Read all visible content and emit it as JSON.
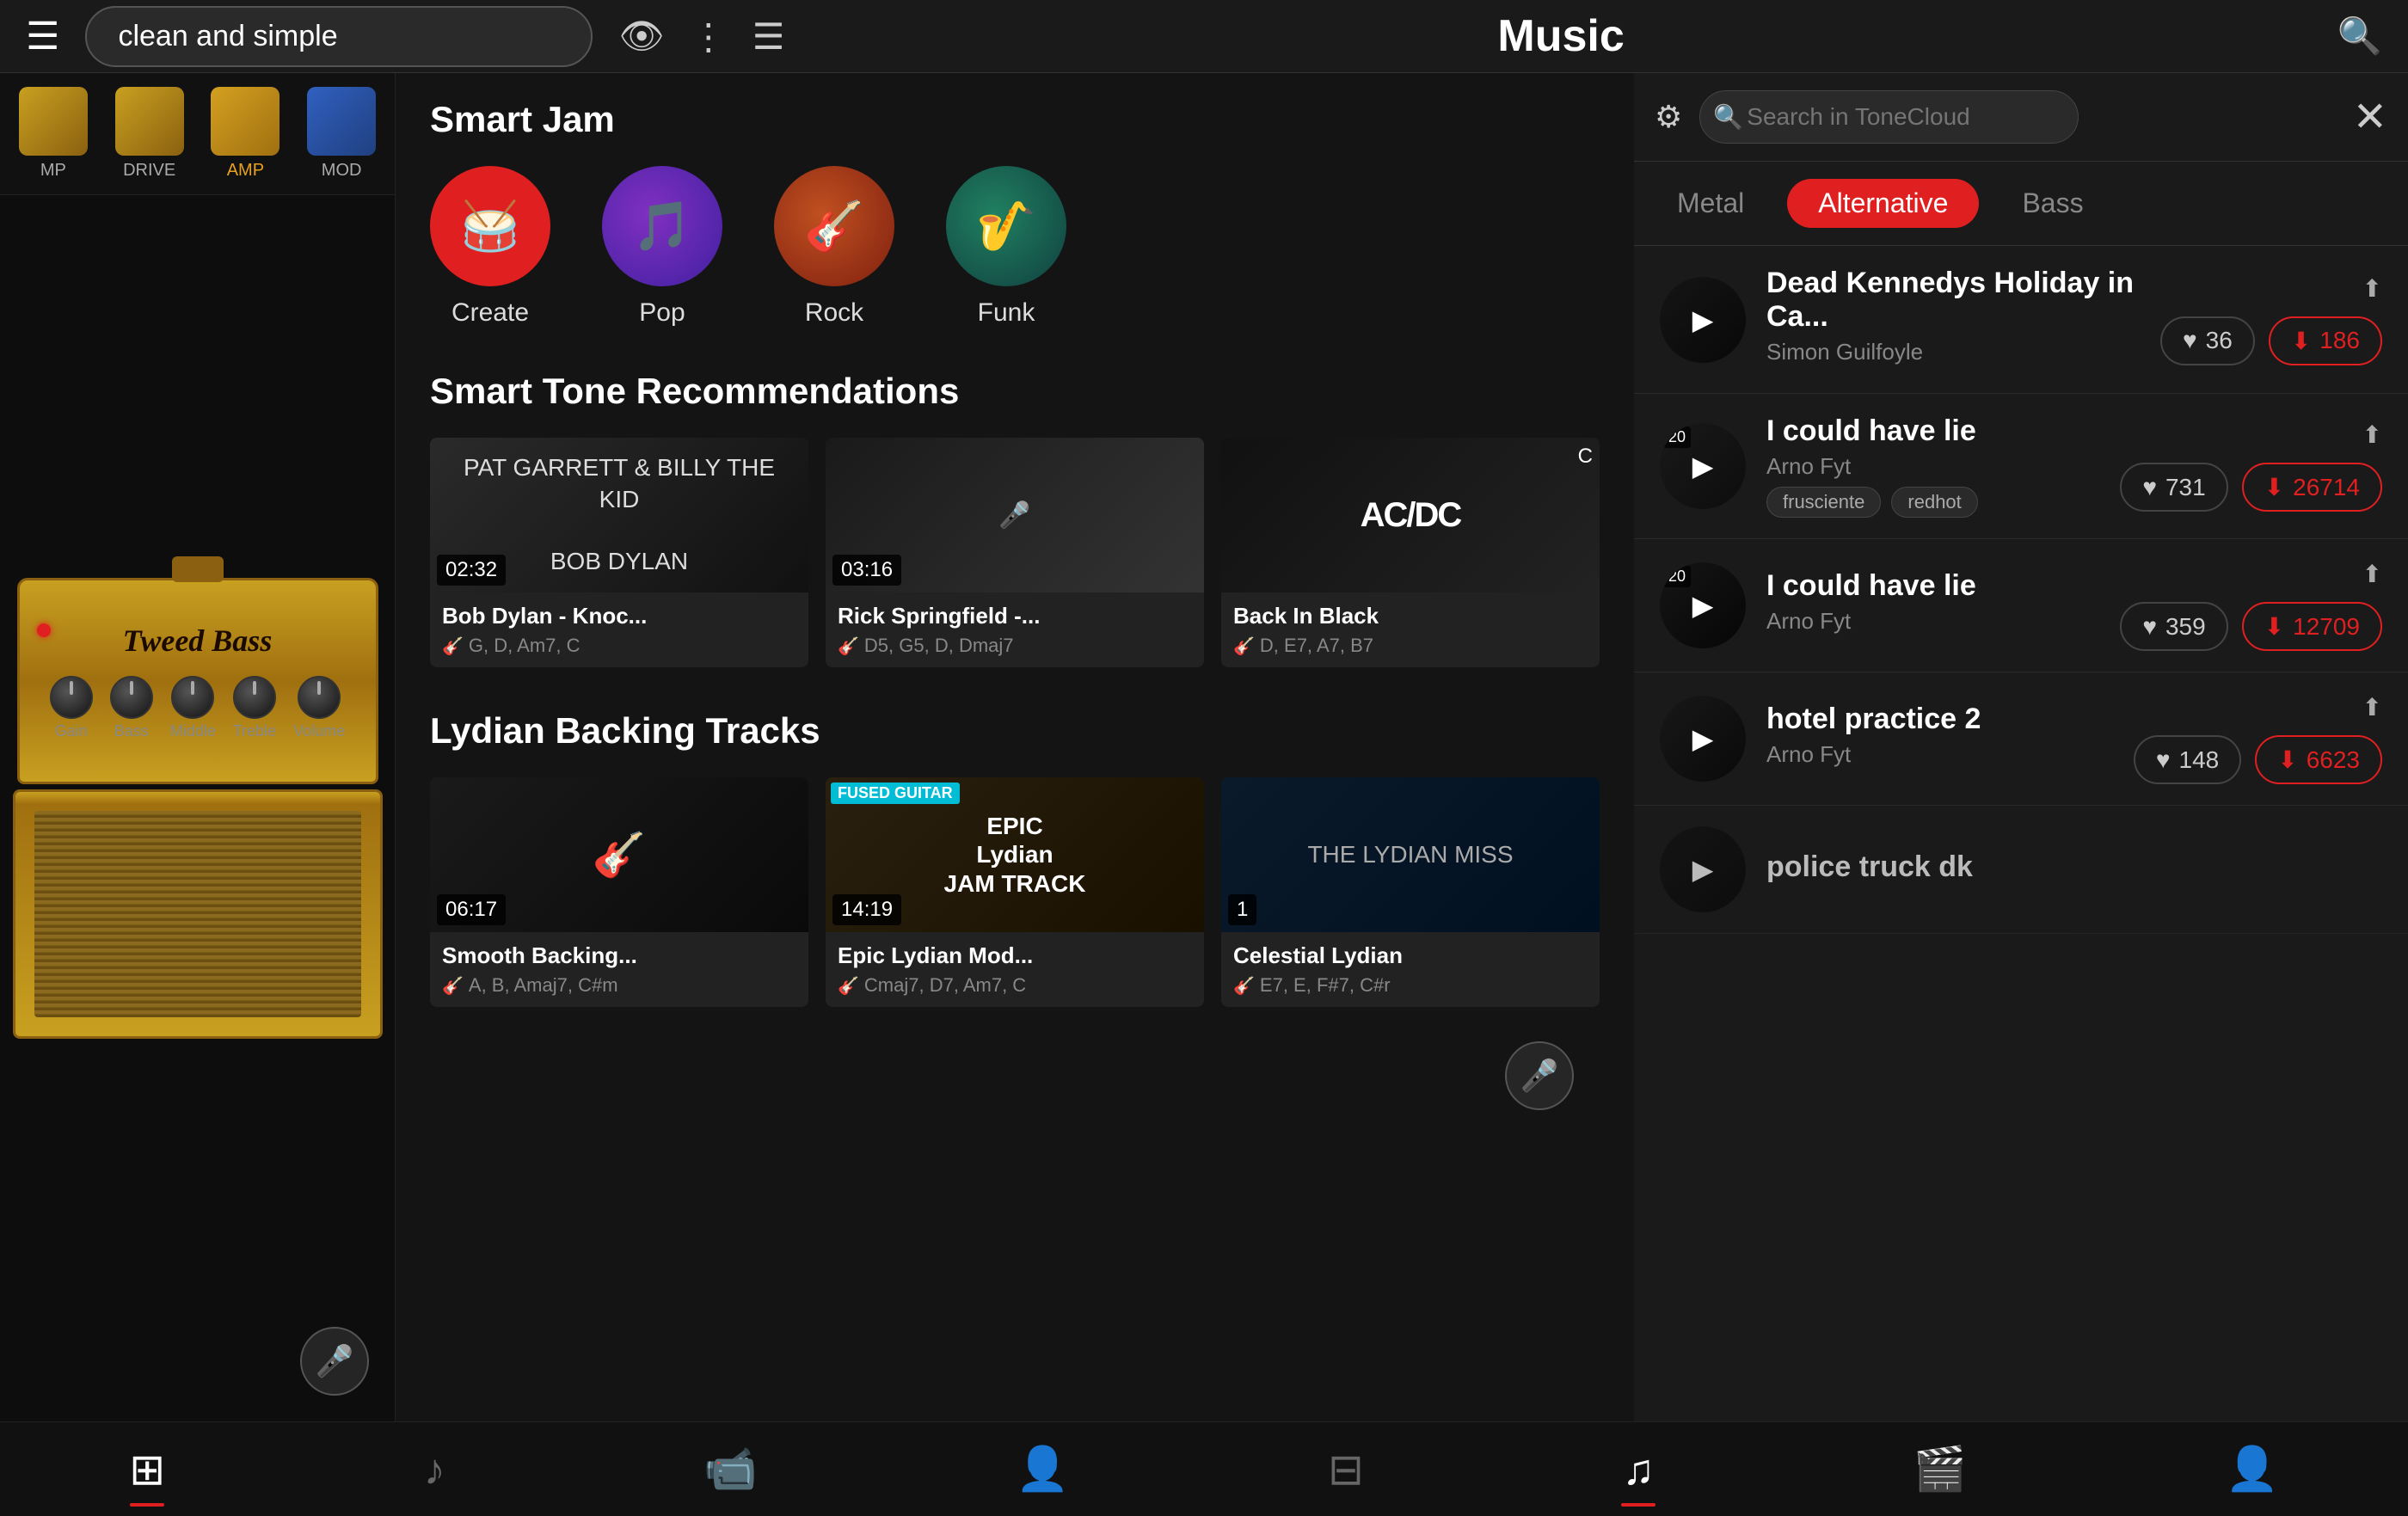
{
  "app": {
    "title": "Music"
  },
  "topBar": {
    "searchValue": "clean and simple",
    "searchPlaceholder": "clean and simple"
  },
  "rightPanel": {
    "searchPlaceholder": "Search in ToneCloud",
    "genres": [
      {
        "id": "metal",
        "label": "Metal",
        "active": false
      },
      {
        "id": "alternative",
        "label": "Alternative",
        "active": true
      },
      {
        "id": "bass",
        "label": "Bass",
        "active": false
      }
    ],
    "tones": [
      {
        "id": "t1",
        "title": "Dead Kennedys Holiday in Ca...",
        "author": "Simon Guilfoyle",
        "tags": [],
        "likes": "36",
        "downloads": "186",
        "hasThumb": true
      },
      {
        "id": "t2",
        "title": "I could have lie",
        "author": "Arno Fyt",
        "tags": [
          "frusciente",
          "redhot"
        ],
        "likes": "731",
        "downloads": "26714",
        "hasThumb": true
      },
      {
        "id": "t3",
        "title": "I could have lie",
        "author": "Arno Fyt",
        "tags": [],
        "likes": "359",
        "downloads": "12709",
        "hasThumb": true
      },
      {
        "id": "t4",
        "title": "hotel practice 2",
        "author": "Arno Fyt",
        "tags": [],
        "likes": "148",
        "downloads": "6623",
        "hasThumb": true
      },
      {
        "id": "t5",
        "title": "police truck dk",
        "author": "",
        "tags": [],
        "likes": "",
        "downloads": "",
        "hasThumb": true,
        "partial": true
      }
    ]
  },
  "leftPanel": {
    "effects": [
      {
        "id": "mp",
        "label": "MP"
      },
      {
        "id": "drive",
        "label": "DRIVE"
      },
      {
        "id": "amp",
        "label": "AMP",
        "highlight": true
      },
      {
        "id": "mod",
        "label": "MOD"
      }
    ],
    "ampName": "Tweed Bass",
    "knobs": [
      {
        "id": "gain",
        "label": "Gain"
      },
      {
        "id": "bass",
        "label": "Bass"
      },
      {
        "id": "middle",
        "label": "Middle"
      },
      {
        "id": "treble",
        "label": "Treble"
      },
      {
        "id": "volume",
        "label": "Volume"
      }
    ]
  },
  "centerPanel": {
    "smartJam": {
      "title": "Smart Jam",
      "items": [
        {
          "id": "create",
          "label": "Create",
          "icon": "🥁"
        },
        {
          "id": "pop",
          "label": "Pop",
          "icon": "🎵"
        },
        {
          "id": "rock",
          "label": "Rock",
          "icon": "🎸"
        },
        {
          "id": "funk",
          "label": "Funk",
          "icon": "🎷"
        }
      ]
    },
    "smartTone": {
      "title": "Smart Tone Recommendations",
      "videos": [
        {
          "id": "v1",
          "title": "Bob Dylan - Knoc...",
          "chords": "G, D, Am7, C",
          "duration": "02:32",
          "thumbType": "dylan"
        },
        {
          "id": "v2",
          "title": "Rick Springfield -...",
          "chords": "D5, G5, D, Dmaj7",
          "duration": "03:16",
          "thumbType": "springfield"
        },
        {
          "id": "v3",
          "title": "Back In Black",
          "chords": "D, E7, A7, B7",
          "duration": "",
          "thumbType": "acdc"
        }
      ]
    },
    "lydian": {
      "title": "Lydian Backing Tracks",
      "videos": [
        {
          "id": "lv1",
          "title": "Smooth Backing...",
          "chords": "A, B, Amaj7, C#m",
          "duration": "06:17",
          "thumbType": "smooth"
        },
        {
          "id": "lv2",
          "title": "Epic Lydian Mod...",
          "chords": "Cmaj7, D7, Am7, C",
          "duration": "14:19",
          "thumbType": "epic"
        },
        {
          "id": "lv3",
          "title": "Celestial Lydian",
          "chords": "E7, E, F#7, C#r",
          "duration": "1",
          "thumbType": "lydian"
        }
      ]
    }
  },
  "bottomNav": {
    "items": [
      {
        "id": "rig",
        "icon": "⊞",
        "active": true
      },
      {
        "id": "music-left",
        "icon": "♪",
        "active": false
      },
      {
        "id": "video-left",
        "icon": "📹",
        "active": false
      },
      {
        "id": "profile-left",
        "icon": "👤",
        "active": false
      },
      {
        "id": "rig2",
        "icon": "⊟",
        "active": false
      },
      {
        "id": "music-center",
        "icon": "♫",
        "active": true
      },
      {
        "id": "video-center",
        "icon": "🎬",
        "active": false
      },
      {
        "id": "profile-center",
        "icon": "👤",
        "active": false
      }
    ]
  }
}
